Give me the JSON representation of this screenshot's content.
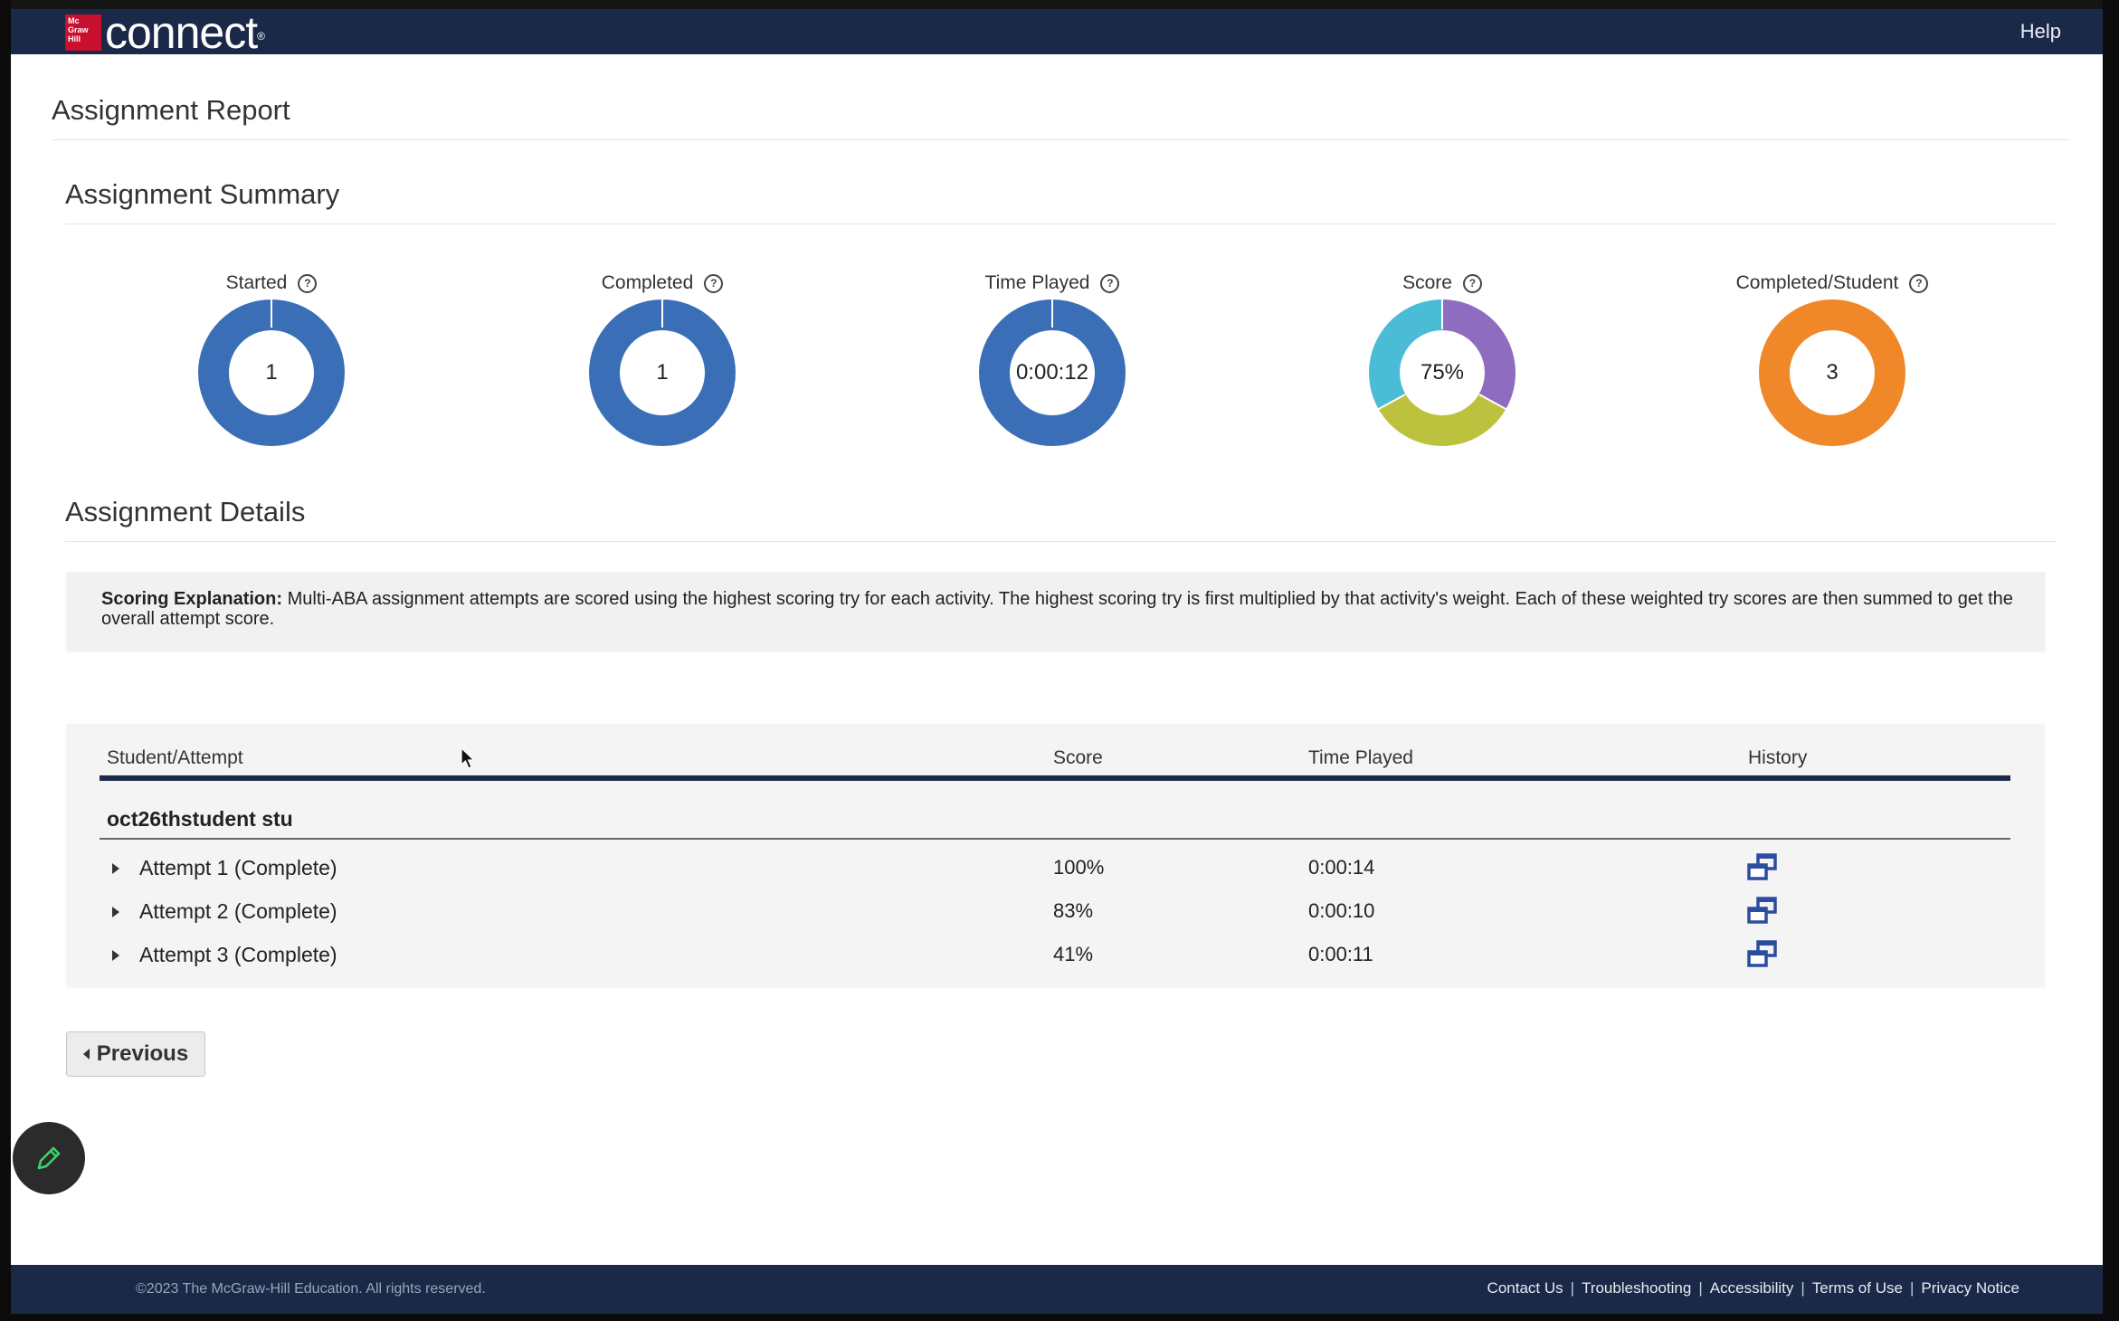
{
  "header": {
    "logo_small": "Mc Graw Hill",
    "logo_word": "connect",
    "help": "Help"
  },
  "page_title": "Assignment Report",
  "summary": {
    "title": "Assignment Summary",
    "metrics": [
      {
        "label": "Started",
        "value": "1",
        "color": "#3a6fb8"
      },
      {
        "label": "Completed",
        "value": "1",
        "color": "#3a6fb8"
      },
      {
        "label": "Time Played",
        "value": "0:00:12",
        "color": "#3a6fb8"
      },
      {
        "label": "Score",
        "value": "75%",
        "colors": [
          "#8e6cc0",
          "#bcc23e",
          "#4bbcd6"
        ]
      },
      {
        "label": "Completed/Student",
        "value": "3",
        "color": "#f0882a"
      }
    ]
  },
  "details": {
    "title": "Assignment Details",
    "scoring_label": "Scoring Explanation:",
    "scoring_text": "Multi-ABA assignment attempts are scored using the highest scoring try for each activity. The highest scoring try is first multiplied by that activity's weight. Each of these weighted try scores are then summed to get the overall attempt score."
  },
  "table": {
    "columns": [
      "Student/Attempt",
      "Score",
      "Time Played",
      "History"
    ],
    "student": "oct26thstudent stu",
    "rows": [
      {
        "attempt": "Attempt 1 (Complete)",
        "score": "100%",
        "time": "0:00:14"
      },
      {
        "attempt": "Attempt 2 (Complete)",
        "score": "83%",
        "time": "0:00:10"
      },
      {
        "attempt": "Attempt 3 (Complete)",
        "score": "41%",
        "time": "0:00:11"
      }
    ]
  },
  "previous_button": "Previous",
  "footer": {
    "copyright": "©2023 The McGraw-Hill Education. All rights reserved.",
    "links": [
      "Contact Us",
      "Troubleshooting",
      "Accessibility",
      "Terms of Use",
      "Privacy Notice"
    ]
  },
  "colors": {
    "navbar": "#1b2948",
    "donut_blue": "#3a6fb8",
    "donut_orange": "#f0882a"
  }
}
